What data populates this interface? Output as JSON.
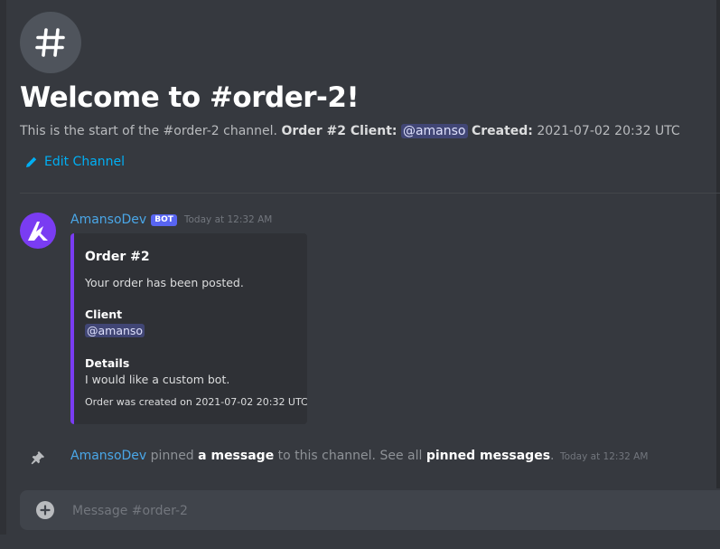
{
  "welcome": {
    "title": "Welcome to #order-2!",
    "desc_prefix": "This is the start of the #order-2 channel.",
    "order_label": "Order #2 Client:",
    "client_mention": "@amanso",
    "created_label": "Created:",
    "created_value": "2021-07-02 20:32 UTC",
    "edit_channel_label": "Edit Channel"
  },
  "message": {
    "author": "AmansoDev",
    "bot_tag": "BOT",
    "timestamp": "Today at 12:32 AM",
    "embed": {
      "accent_color": "#7a3cf2",
      "title": "Order #2",
      "description": "Your order has been posted.",
      "fields": [
        {
          "name": "Client",
          "value": "@amanso"
        },
        {
          "name": "Details",
          "value": "I would like a custom bot."
        }
      ],
      "footer": "Order was created on 2021-07-02 20:32 UTC"
    }
  },
  "pin_notice": {
    "author": "AmansoDev",
    "text_1": "pinned",
    "link_1": "a message",
    "text_2": "to this channel. See all",
    "link_2": "pinned messages",
    "text_3": ".",
    "timestamp": "Today at 12:32 AM"
  },
  "composer": {
    "placeholder": "Message #order-2"
  },
  "icons": {
    "channel": "hash-icon",
    "edit": "pencil-icon",
    "avatar": "bot-avatar-logo",
    "pin": "pin-icon",
    "add": "plus-circle-icon"
  }
}
